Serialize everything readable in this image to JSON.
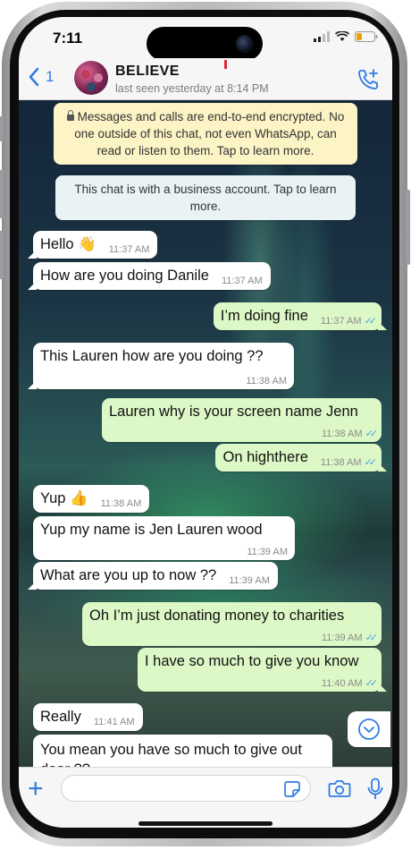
{
  "status_bar": {
    "time": "7:11"
  },
  "header": {
    "back_count": "1",
    "contact_name": "BELIEVE",
    "last_seen": "last seen yesterday at 8:14 PM"
  },
  "system_messages": {
    "encryption": "Messages and calls are end-to-end encrypted. No one outside of this chat, not even WhatsApp, can read or listen to them. Tap to learn more.",
    "business": "This chat is with a business account. Tap to learn more."
  },
  "messages": [
    {
      "dir": "in",
      "text": "Hello 👋",
      "time": "11:37 AM"
    },
    {
      "dir": "in",
      "text": "How are you doing Danile",
      "time": "11:37 AM"
    },
    {
      "dir": "out",
      "text": "I’m doing fine",
      "time": "11:37 AM"
    },
    {
      "dir": "in",
      "text": "This Lauren how are you doing ??",
      "time": "11:38 AM"
    },
    {
      "dir": "out",
      "text": "Lauren why is your screen name Jenn",
      "time": "11:38 AM"
    },
    {
      "dir": "out",
      "text": "On highthere",
      "time": "11:38 AM"
    },
    {
      "dir": "in",
      "text": "Yup 👍",
      "time": "11:38 AM"
    },
    {
      "dir": "in",
      "text": "Yup my name is Jen Lauren wood",
      "time": "11:39 AM"
    },
    {
      "dir": "in",
      "text": "What are you up to now ??",
      "time": "11:39 AM"
    },
    {
      "dir": "out",
      "text": "Oh I’m just donating money to charities",
      "time": "11:39 AM"
    },
    {
      "dir": "out",
      "text": "I have so much to give you know",
      "time": "11:40 AM"
    },
    {
      "dir": "in",
      "text": "Really",
      "time": "11:41 AM"
    },
    {
      "dir": "in",
      "text": "You mean you have so much to give out dear ??",
      "time": ""
    }
  ],
  "input": {
    "placeholder": ""
  },
  "colors": {
    "accent": "#2f7ce0",
    "outgoing_bubble": "#dcf8c6",
    "incoming_bubble": "#ffffff",
    "encryption_bg": "#fdf4c5",
    "read_tick": "#4fa3e3"
  },
  "icons": [
    "back-chevron-icon",
    "add-call-icon",
    "lock-icon",
    "double-check-icon",
    "chevron-down-icon",
    "plus-icon",
    "sticker-icon",
    "camera-icon",
    "microphone-icon"
  ]
}
